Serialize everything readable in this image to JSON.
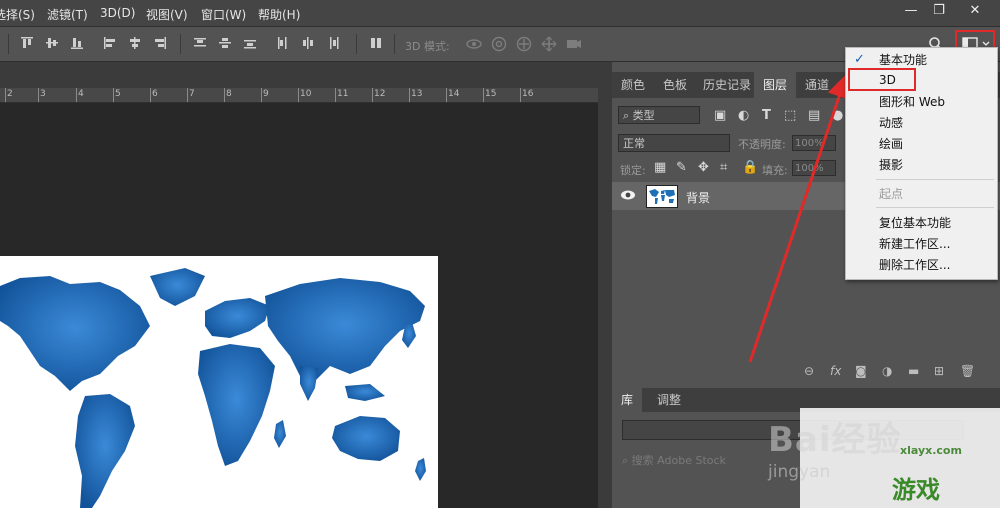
{
  "menubar": {
    "items": [
      "选择(S)",
      "滤镜(T)",
      "3D(D)",
      "视图(V)",
      "窗口(W)",
      "帮助(H)"
    ],
    "menu_x": [
      -6,
      47,
      100,
      146,
      201,
      258
    ],
    "window_controls": {
      "minimize": "—",
      "restore": "❐",
      "close": "✕"
    }
  },
  "options_bar": {
    "mode3d_label": "3D 模式:",
    "icons": [
      "align-top-icon",
      "align-vcenter-icon",
      "align-bottom-icon",
      "align-left-icon",
      "align-hcenter-icon",
      "align-right-icon",
      "distribute-top-icon",
      "distribute-vcenter-icon",
      "distribute-bottom-icon",
      "distribute-left-icon",
      "distribute-hcenter-icon",
      "distribute-right-icon",
      "auto-align-icon"
    ]
  },
  "ruler": {
    "ticks": [
      "2",
      "3",
      "4",
      "5",
      "6",
      "7",
      "8",
      "9",
      "10",
      "11",
      "12",
      "13",
      "14",
      "15",
      "16"
    ]
  },
  "panels": {
    "tabs": [
      "颜色",
      "色板",
      "历史记录",
      "图层",
      "通道"
    ],
    "active_tab": "图层",
    "filter_kind": "类型",
    "blend_mode": "正常",
    "opacity_label": "不透明度:",
    "opacity_value": "100%",
    "lock_label": "锁定:",
    "fill_label": "填充:",
    "fill_value": "100%",
    "layer_name": "背景",
    "library_tabs": [
      "库",
      "调整"
    ],
    "stock_search_placeholder": "搜索 Adobe Stock"
  },
  "workspace_menu": {
    "items": [
      {
        "label": "基本功能",
        "checked": true,
        "enabled": true
      },
      {
        "label": "3D",
        "checked": false,
        "enabled": true,
        "highlighted_box": true
      },
      {
        "label": "图形和 Web",
        "checked": false,
        "enabled": true
      },
      {
        "label": "动感",
        "checked": false,
        "enabled": true
      },
      {
        "label": "绘画",
        "checked": false,
        "enabled": true
      },
      {
        "label": "摄影",
        "checked": false,
        "enabled": true
      },
      {
        "label": "起点",
        "checked": false,
        "enabled": false
      },
      {
        "label": "复位基本功能",
        "checked": false,
        "enabled": true
      },
      {
        "label": "新建工作区...",
        "checked": false,
        "enabled": true
      },
      {
        "label": "删除工作区...",
        "checked": false,
        "enabled": true
      }
    ],
    "check_glyph": "✓"
  },
  "watermarks": {
    "baidu": "Bai经验",
    "baidu_url": "jingyan",
    "site_url": "xlayx.com",
    "site_brand": "游戏"
  },
  "colors": {
    "highlight_red": "#e02a2a",
    "map_blue": "#1f6fb8",
    "menu_bg": "#f0f0f0"
  }
}
